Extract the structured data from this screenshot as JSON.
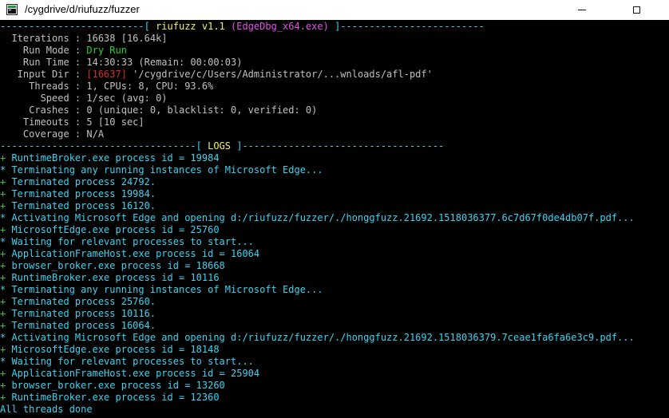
{
  "window": {
    "title": "/cygdrive/d/riufuzz/fuzzer",
    "icon": "terminal-icon",
    "min_glyph": "minimize-icon",
    "max_glyph": "maximize-icon"
  },
  "header": {
    "dash_left": "-------------------------[ ",
    "app_name": "riufuzz v1.1",
    "target_exe": "(EdgeDbg_x64.exe)",
    "dash_right": " ]-------------------------"
  },
  "stats": [
    {
      "label": "  Iterations : ",
      "value": "16638 [16.64k]"
    },
    {
      "label": "    Run Mode : ",
      "value": "Dry Run"
    },
    {
      "label": "    Run Time : ",
      "value": "14:30:33 (Remain: 00:00:03)"
    },
    {
      "label": "   Input Dir : ",
      "prefix": "[16637]",
      "value": " '/cygdrive/c/Users/Administrator/...wnloads/afl-pdf'"
    },
    {
      "label": "     Threads : ",
      "value": "1, CPUs: 8, CPU: 93.6%"
    },
    {
      "label": "       Speed : ",
      "value": "1/sec (avg: 0)"
    },
    {
      "label": "     Crashes : ",
      "value": "0 (unique: 0, blacklist: 0, verified: 0)"
    },
    {
      "label": "    Timeouts : ",
      "value": "5 [10 sec]"
    },
    {
      "label": "    Coverage : ",
      "value": "N/A"
    }
  ],
  "logs_header": {
    "dash_left": "----------------------------------[ ",
    "label": "LOGS",
    "dash_right": " ]-----------------------------------"
  },
  "logs": [
    {
      "marker": "+",
      "text": " RuntimeBroker.exe process id = 19984"
    },
    {
      "marker": "*",
      "text": " Terminating any running instances of Microsoft Edge..."
    },
    {
      "marker": "+",
      "text": " Terminated process 24792."
    },
    {
      "marker": "+",
      "text": " Terminated process 19984."
    },
    {
      "marker": "+",
      "text": " Terminated process 16120."
    },
    {
      "marker": "*",
      "text": " Activating Microsoft Edge and opening d:/riufuzz/fuzzer/./honggfuzz.21692.1518036377.6c7d67f0de4db07f.pdf..."
    },
    {
      "marker": "+",
      "text": " MicrosoftEdge.exe process id = 25760"
    },
    {
      "marker": "*",
      "text": " Waiting for relevant processes to start..."
    },
    {
      "marker": "+",
      "text": " ApplicationFrameHost.exe process id = 16064"
    },
    {
      "marker": "+",
      "text": " browser_broker.exe process id = 18668"
    },
    {
      "marker": "+",
      "text": " RuntimeBroker.exe process id = 10116"
    },
    {
      "marker": "*",
      "text": " Terminating any running instances of Microsoft Edge..."
    },
    {
      "marker": "+",
      "text": " Terminated process 25760."
    },
    {
      "marker": "+",
      "text": " Terminated process 10116."
    },
    {
      "marker": "+",
      "text": " Terminated process 16064."
    },
    {
      "marker": "*",
      "text": " Activating Microsoft Edge and opening d:/riufuzz/fuzzer/./honggfuzz.21692.1518036379.7ceae1fa6fa6e3c9.pdf..."
    },
    {
      "marker": "+",
      "text": " MicrosoftEdge.exe process id = 18148"
    },
    {
      "marker": "*",
      "text": " Waiting for relevant processes to start..."
    },
    {
      "marker": "+",
      "text": " ApplicationFrameHost.exe process id = 25904"
    },
    {
      "marker": "+",
      "text": " browser_broker.exe process id = 13260"
    },
    {
      "marker": "+",
      "text": " RuntimeBroker.exe process id = 12360"
    }
  ],
  "footer": "All threads done"
}
